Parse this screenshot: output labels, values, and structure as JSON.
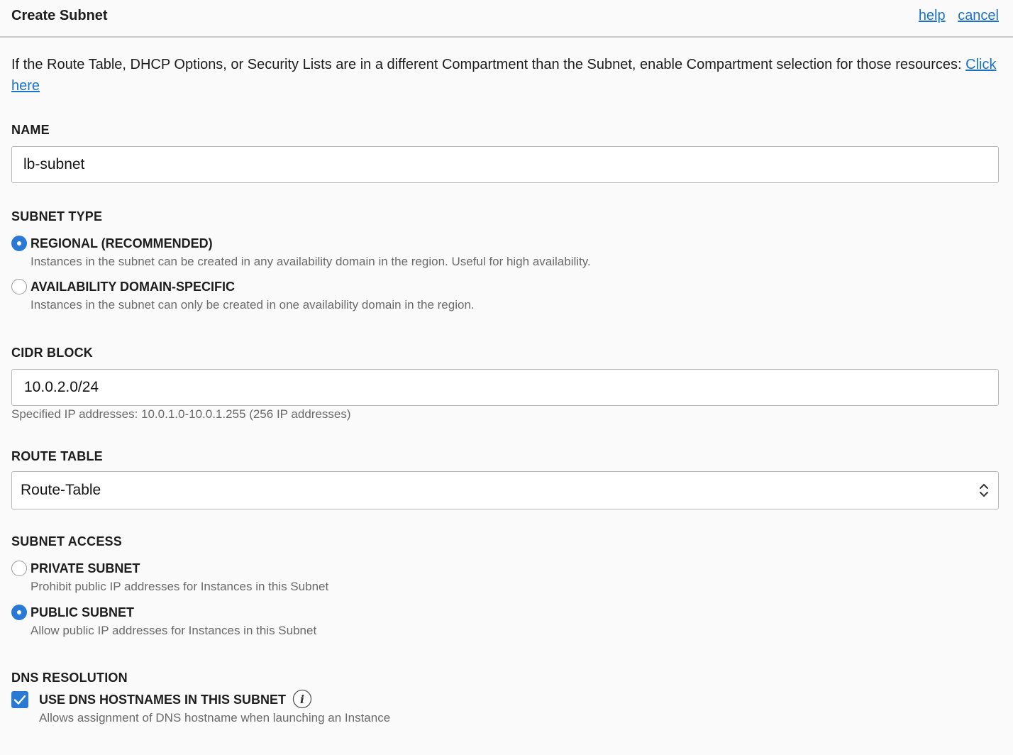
{
  "header": {
    "title": "Create Subnet",
    "help_label": "help",
    "cancel_label": "cancel"
  },
  "intro": {
    "text": "If the Route Table, DHCP Options, or Security Lists are in a different Compartment than the Subnet, enable Compartment selection for those resources:",
    "link_label": "Click here"
  },
  "name": {
    "label": "NAME",
    "value": "lb-subnet"
  },
  "subnet_type": {
    "label": "SUBNET TYPE",
    "options": [
      {
        "label": "REGIONAL (RECOMMENDED)",
        "description": "Instances in the subnet can be created in any availability domain in the region. Useful for high availability.",
        "selected": true
      },
      {
        "label": "AVAILABILITY DOMAIN-SPECIFIC",
        "description": "Instances in the subnet can only be created in one availability domain in the region.",
        "selected": false
      }
    ]
  },
  "cidr": {
    "label": "CIDR BLOCK",
    "value": "10.0.2.0/24",
    "hint": "Specified IP addresses: 10.0.1.0-10.0.1.255 (256 IP addresses)"
  },
  "route_table": {
    "label": "ROUTE TABLE",
    "selected": "Route-Table"
  },
  "subnet_access": {
    "label": "SUBNET ACCESS",
    "options": [
      {
        "label": "PRIVATE SUBNET",
        "description": "Prohibit public IP addresses for Instances in this Subnet",
        "selected": false
      },
      {
        "label": "PUBLIC SUBNET",
        "description": "Allow public IP addresses for Instances in this Subnet",
        "selected": true
      }
    ]
  },
  "dns": {
    "label": "DNS RESOLUTION",
    "checkbox_label": "USE DNS HOSTNAMES IN THIS SUBNET",
    "checked": true,
    "description": "Allows assignment of DNS hostname when launching an Instance",
    "info_icon": "info-icon"
  },
  "colors": {
    "accent": "#2a79d4",
    "link": "#1a73c8"
  }
}
